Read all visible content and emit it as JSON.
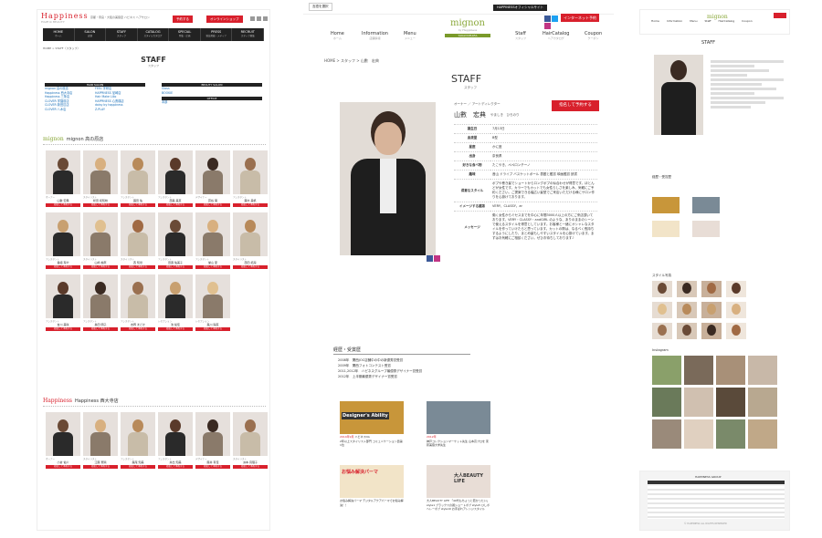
{
  "p1": {
    "logo": "Happiness",
    "logo_sub": "HAIR & BEAUTY",
    "tagline": "京都・奈良・大阪の美容室 ハピネス ヘアサロン",
    "reserve_label": "予約する",
    "online_shop_label": "オンラインショップ",
    "nav": [
      {
        "en": "HOME",
        "jp": "ホーム"
      },
      {
        "en": "SALON",
        "jp": "店舗"
      },
      {
        "en": "STAFF",
        "jp": "スタッフ"
      },
      {
        "en": "CATALOG",
        "jp": "スタイルカタログ"
      },
      {
        "en": "SPECIAL",
        "jp": "特集・企画"
      },
      {
        "en": "PRESS",
        "jp": "雑誌掲載・メディア"
      },
      {
        "en": "RECRUIT",
        "jp": "スタッフ募集"
      }
    ],
    "breadcrumb": "HOME > STAFF（スタッフ）",
    "title": "STAFF",
    "subtitle": "スタッフ",
    "hair_salon_header": "HAIR SALON",
    "hair_salons_left": [
      "mignon 高の原店",
      "Happiness 西大寺店",
      "Happiness 三条店",
      "CLOVER 学園前店",
      "CLOVER 新田辺店",
      "CLOVER 八木店"
    ],
    "hair_salons_right": [
      "FEEL 学研店",
      "HAPPINESS 尼崎店",
      "Hair Make Lilio",
      "HAPPINESS 心斎橋店",
      "daisy by happiness",
      "Z-PLAY"
    ],
    "beauty_salon_header": "BEAUTY SALON",
    "beauty_salons": [
      "Gloss",
      "BOOKIE"
    ],
    "office_header": "OFFICE",
    "office": [
      "本部"
    ],
    "shop1_logo": "mignon",
    "shop1_name": "mignon 高の原店",
    "shop2_logo": "Happiness",
    "shop2_name": "Happiness 西大寺店",
    "book_btn": "指名して予約する",
    "shop1_staff": [
      {
        "role": "オーナー",
        "name": "山數 宏典"
      },
      {
        "role": "スタイリスト",
        "name": "松田 和知枝"
      },
      {
        "role": "アシスタント",
        "name": "園田 佑"
      },
      {
        "role": "アシスタント",
        "name": "西森 美恵"
      },
      {
        "role": "デザイナー",
        "name": "蒼谷 萌"
      },
      {
        "role": "アシスタント",
        "name": "蘇木 美帆"
      },
      {
        "role": "アシスタント",
        "name": "番組 有紗"
      },
      {
        "role": "スタイリスト",
        "name": "山崎 柚奈"
      },
      {
        "role": "スタイリスト",
        "name": "西 知世"
      },
      {
        "role": "アシスタント",
        "name": "田邉 佑美子"
      },
      {
        "role": "アシスタント",
        "name": "堂山 愛"
      },
      {
        "role": "スタイリスト",
        "name": "西田 拓海"
      },
      {
        "role": "アシスタント",
        "name": "吉川 美咲"
      },
      {
        "role": "アシスタント",
        "name": "奥田 明子"
      },
      {
        "role": "アシスタント",
        "name": "吉岡 まどか"
      },
      {
        "role": "レセプション",
        "name": "池 綾佳"
      },
      {
        "role": "レセプション",
        "name": "森川 陽菜"
      }
    ],
    "shop2_staff": [
      {
        "role": "オーナー",
        "name": "小倉 佑介"
      },
      {
        "role": "スタイリスト",
        "name": "江藤 瑠璃"
      },
      {
        "role": "アシスタント",
        "name": "森尾 知美"
      },
      {
        "role": "アシスタント",
        "name": "井出 知美"
      },
      {
        "role": "デザイナー",
        "name": "藤井 有佳"
      },
      {
        "role": "スタイリスト",
        "name": "洲本 真理子"
      }
    ]
  },
  "p2": {
    "lang_label": "言語を選択",
    "official_site": "HAPPINESSオフィシャルサイト",
    "net_reserve": "インターネット予約",
    "logo": "mignon",
    "logo_sub": "by Happiness",
    "logo_band": "TAKANOHARA",
    "nav": [
      {
        "en": "Home",
        "jp": "ホーム"
      },
      {
        "en": "Information",
        "jp": "店舗情報"
      },
      {
        "en": "Menu",
        "jp": "メニュー"
      },
      {
        "en": "Staff",
        "jp": "スタッフ"
      },
      {
        "en": "HairCatalog",
        "jp": "ヘアカタログ"
      },
      {
        "en": "Coupon",
        "jp": "クーポン"
      }
    ],
    "breadcrumb": "HOME > スタッフ > 山數　宏典",
    "title": "STAFF",
    "subtitle": "スタッフ",
    "role": "オーナー ／ アートディレクター",
    "name": "山數　宏典",
    "furigana": "やましき　ひろのり",
    "reserve_btn": "指名して予約する",
    "profile": [
      {
        "k": "誕生日",
        "v": "7月13日"
      },
      {
        "k": "血液型",
        "v": "B型"
      },
      {
        "k": "星座",
        "v": "かに座"
      },
      {
        "k": "出身",
        "v": "奈良県"
      },
      {
        "k": "好きな食べ物",
        "v": "たこやき、ペペロンチーノ"
      },
      {
        "k": "趣味",
        "v": "音山 ドライブ バスケットボール 表題と鑑賞 映画鑑賞 読書"
      },
      {
        "k": "得意なスタイル",
        "v": "ボブや巻き髪でショートからロングボブの似合わせが得意です。ほとんどが女性です。カラーでもカットでも女性らしさを楽しみ、気軽にご予約ください。ご提案できる幅広い髪型でご来店いただける様にサロン作りを心掛けております。"
      },
      {
        "k": "イメージする雑誌",
        "v": "VERY、CLASSY。ar"
      },
      {
        "k": "メッセージ",
        "v": "働く女性からミセスまでを中心に年間3000人以上の方にご来店頂いております。VERY・CLASSY・andGIRL のような、ありのままのシーンで使えるスタイルを得意としています。お客様と一緒にオシャレなスタイルを作っていけたらと思っています。カットの際は、なるべく長持ちするようにしたり、まとめ髪もしやすいスタイルを心掛けています。まずはお気軽にご相談ください。ぜひお待ちしております♪"
      }
    ],
    "career_title": "経歴・受賞歴",
    "career": [
      "2008年　関西JOC店舗中の中の新優秀賞受賞",
      "2009年　関西フォトコンテスト受賞",
      "2011,2012年　ハピネスグループ最優秀デザイナー賞受賞",
      "2012年　上半期最優秀デザイナー賞受賞"
    ],
    "blog": [
      {
        "img": "Designer's Ability",
        "date": "2014年9月",
        "title": "ハピネスDA",
        "text": "2年以上スタイリスト部門 コミュニケーション賞第1位"
      },
      {
        "img": "",
        "date": "2012年",
        "title": "",
        "text": "神戸コレクションマーケット先生 山本高プロを 東邦美容大学先生"
      },
      {
        "img": "お悩み解決パーマ",
        "date": "",
        "title": "",
        "text": "お悩み解決パーマ デジタルアクアパーマでお悩み解決！！"
      },
      {
        "img": "大人BEAUTY LIFE",
        "date": "",
        "title": "",
        "text": "大人BEAUTY LIFE 「40代もちょっと若かったい」 style1 ブラックスの親ショートボブ style5 ひしボヘレーボブ style10 お手ばれアレンジスタイル"
      }
    ]
  },
  "p3": {
    "nav": [
      "Home",
      "Information",
      "Menu",
      "Staff",
      "HairCatalog",
      "Coupon"
    ],
    "title": "STAFF",
    "career_title": "経歴・受賞歴",
    "styles_title": "スタイル写真",
    "instagram_title": "Instagram",
    "footer_title": "HAPPINESS GROUP",
    "copyright": "© HAPPINESS ALL RIGHTS RESERVED"
  },
  "colors": {
    "accent": "#d8202c",
    "mignon": "#8aa83a",
    "nav": "#222222",
    "link": "#1a6fb8"
  }
}
